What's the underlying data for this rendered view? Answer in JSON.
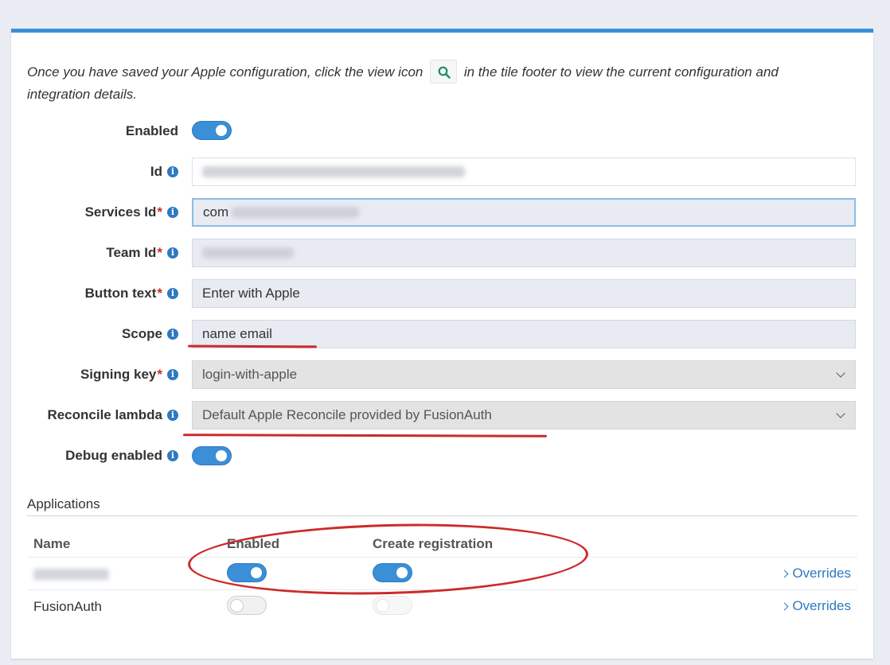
{
  "intro": {
    "before_icon": "Once you have saved your Apple configuration, click the view icon",
    "after_icon": "in the tile footer to view the current configuration and integration details.",
    "icon": "search-icon"
  },
  "form": {
    "enabled_label": "Enabled",
    "enabled_value": true,
    "id_label": "Id",
    "services_id_label": "Services Id",
    "services_id_value": "com",
    "team_id_label": "Team Id",
    "button_text_label": "Button text",
    "button_text_value": "Enter with Apple",
    "scope_label": "Scope",
    "scope_value": "name email",
    "signing_key_label": "Signing key",
    "signing_key_value": "login-with-apple",
    "reconcile_lambda_label": "Reconcile lambda",
    "reconcile_lambda_value": "Default Apple Reconcile provided by FusionAuth",
    "debug_enabled_label": "Debug enabled",
    "debug_enabled_value": true,
    "required_marker": "*"
  },
  "applications": {
    "heading": "Applications",
    "columns": [
      "Name",
      "Enabled",
      "Create registration"
    ],
    "rows": [
      {
        "name": "",
        "enabled": true,
        "create_registration": true,
        "overrides_label": "Overrides"
      },
      {
        "name": "FusionAuth",
        "enabled": false,
        "create_registration": false,
        "overrides_label": "Overrides"
      }
    ]
  },
  "colors": {
    "accent": "#3a8fd6",
    "annotation": "#cc2b2b",
    "link": "#2e79c2"
  }
}
